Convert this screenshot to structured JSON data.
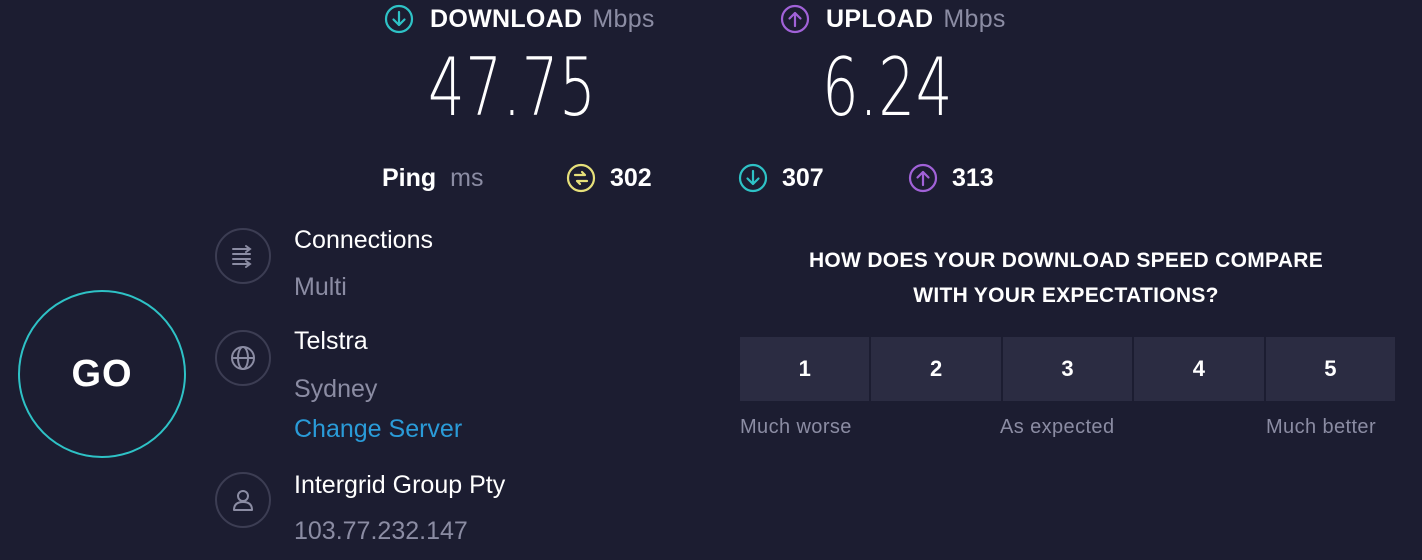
{
  "download": {
    "label": "DOWNLOAD",
    "unit": "Mbps",
    "value": "47.75",
    "icon": "download-arrow-icon",
    "color": "#2ec2c6"
  },
  "upload": {
    "label": "UPLOAD",
    "unit": "Mbps",
    "value": "6.24",
    "icon": "upload-arrow-icon",
    "color": "#a162d8"
  },
  "ping": {
    "label": "Ping",
    "unit": "ms",
    "idle": {
      "value": "302",
      "icon": "idle-ping-icon",
      "color": "#e6e07a"
    },
    "download": {
      "value": "307",
      "icon": "download-ping-icon",
      "color": "#2ec2c6"
    },
    "upload": {
      "value": "313",
      "icon": "upload-ping-icon",
      "color": "#a162d8"
    }
  },
  "go_button": {
    "label": "GO",
    "color": "#2ec2c6"
  },
  "connections": {
    "title": "Connections",
    "value": "Multi",
    "icon": "connections-icon"
  },
  "server": {
    "title": "Telstra",
    "location": "Sydney",
    "change_label": "Change Server",
    "icon": "globe-icon",
    "link_color": "#2a9bd8"
  },
  "provider": {
    "name": "Intergrid Group Pty",
    "ip": "103.77.232.147",
    "icon": "user-icon"
  },
  "survey": {
    "question_line1": "HOW DOES YOUR DOWNLOAD SPEED COMPARE",
    "question_line2": "WITH YOUR EXPECTATIONS?",
    "options": [
      "1",
      "2",
      "3",
      "4",
      "5"
    ],
    "caption_low": "Much worse",
    "caption_mid": "As expected",
    "caption_high": "Much better"
  }
}
